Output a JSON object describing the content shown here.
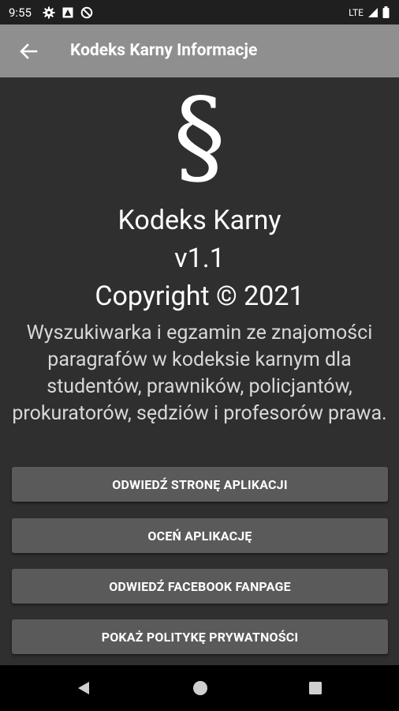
{
  "status_bar": {
    "time": "9:55",
    "network": "LTE"
  },
  "app_bar": {
    "title": "Kodeks Karny Informacje"
  },
  "logo_symbol": "§",
  "about": {
    "app_name": "Kodeks Karny",
    "version": "v1.1",
    "copyright": "Copyright © 2021",
    "description": "Wyszukiwarka i egzamin ze znajomości paragrafów w kodeksie karnym dla studentów, prawników, policjantów, prokuratorów, sędziów i profesorów prawa."
  },
  "buttons": [
    {
      "label": "ODWIEDŹ STRONĘ APLIKACJI"
    },
    {
      "label": "OCEŃ APLIKACJĘ"
    },
    {
      "label": "ODWIEDŹ FACEBOOK FANPAGE"
    },
    {
      "label": "POKAŻ POLITYKĘ PRYWATNOŚCI"
    }
  ],
  "colors": {
    "app_bar": "#8f8f8f",
    "background": "#2f2f2f",
    "button": "#5a5a5a",
    "status_bar": "#1f1f1f",
    "nav_bar": "#000000"
  }
}
